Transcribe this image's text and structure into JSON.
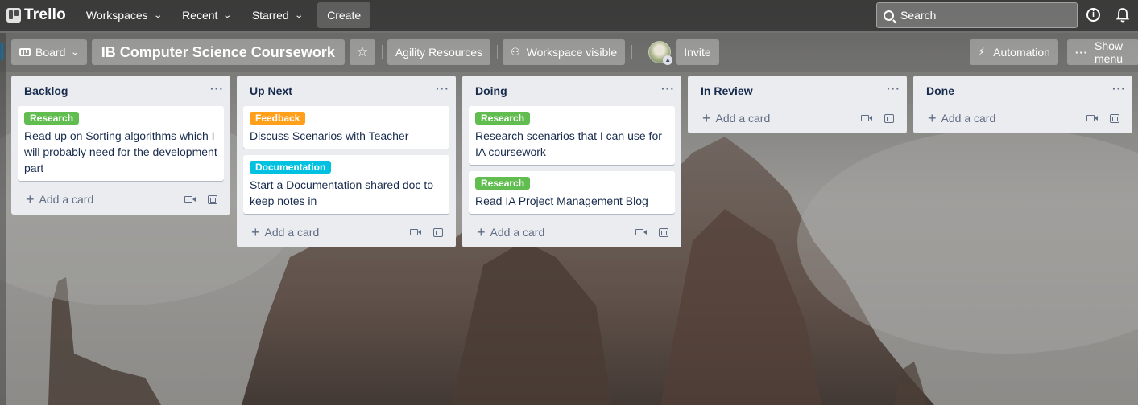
{
  "header": {
    "logo_text": "Trello",
    "nav": [
      {
        "label": "Workspaces"
      },
      {
        "label": "Recent"
      },
      {
        "label": "Starred"
      }
    ],
    "create_label": "Create",
    "search_placeholder": "Search",
    "info_icon": "i"
  },
  "board": {
    "switcher_label": "Board",
    "title": "IB Computer Science Coursework",
    "star_icon": "☆",
    "workspace_name": "Agility Resources",
    "visibility_label": "Workspace visible",
    "invite_label": "Invite",
    "automation_label": "Automation",
    "show_menu_label": "Show menu"
  },
  "labels": {
    "Research": "#61bd4f",
    "Feedback": "#ff9f1a",
    "Documentation": "#00c2e0"
  },
  "lists": [
    {
      "title": "Backlog",
      "cards": [
        {
          "label": "Research",
          "text": "Read up on Sorting algorithms which I will probably need for the development part"
        }
      ]
    },
    {
      "title": "Up Next",
      "cards": [
        {
          "label": "Feedback",
          "text": "Discuss Scenarios with Teacher"
        },
        {
          "label": "Documentation",
          "text": "Start a Documentation shared doc to keep notes in"
        }
      ]
    },
    {
      "title": "Doing",
      "cards": [
        {
          "label": "Research",
          "text": "Research scenarios that I can use for IA coursework"
        },
        {
          "label": "Research",
          "text": "Read IA Project Management Blog"
        }
      ]
    },
    {
      "title": "In Review",
      "cards": []
    },
    {
      "title": "Done",
      "cards": []
    }
  ],
  "add_card_label": "Add a card",
  "list_menu_icon": "···"
}
